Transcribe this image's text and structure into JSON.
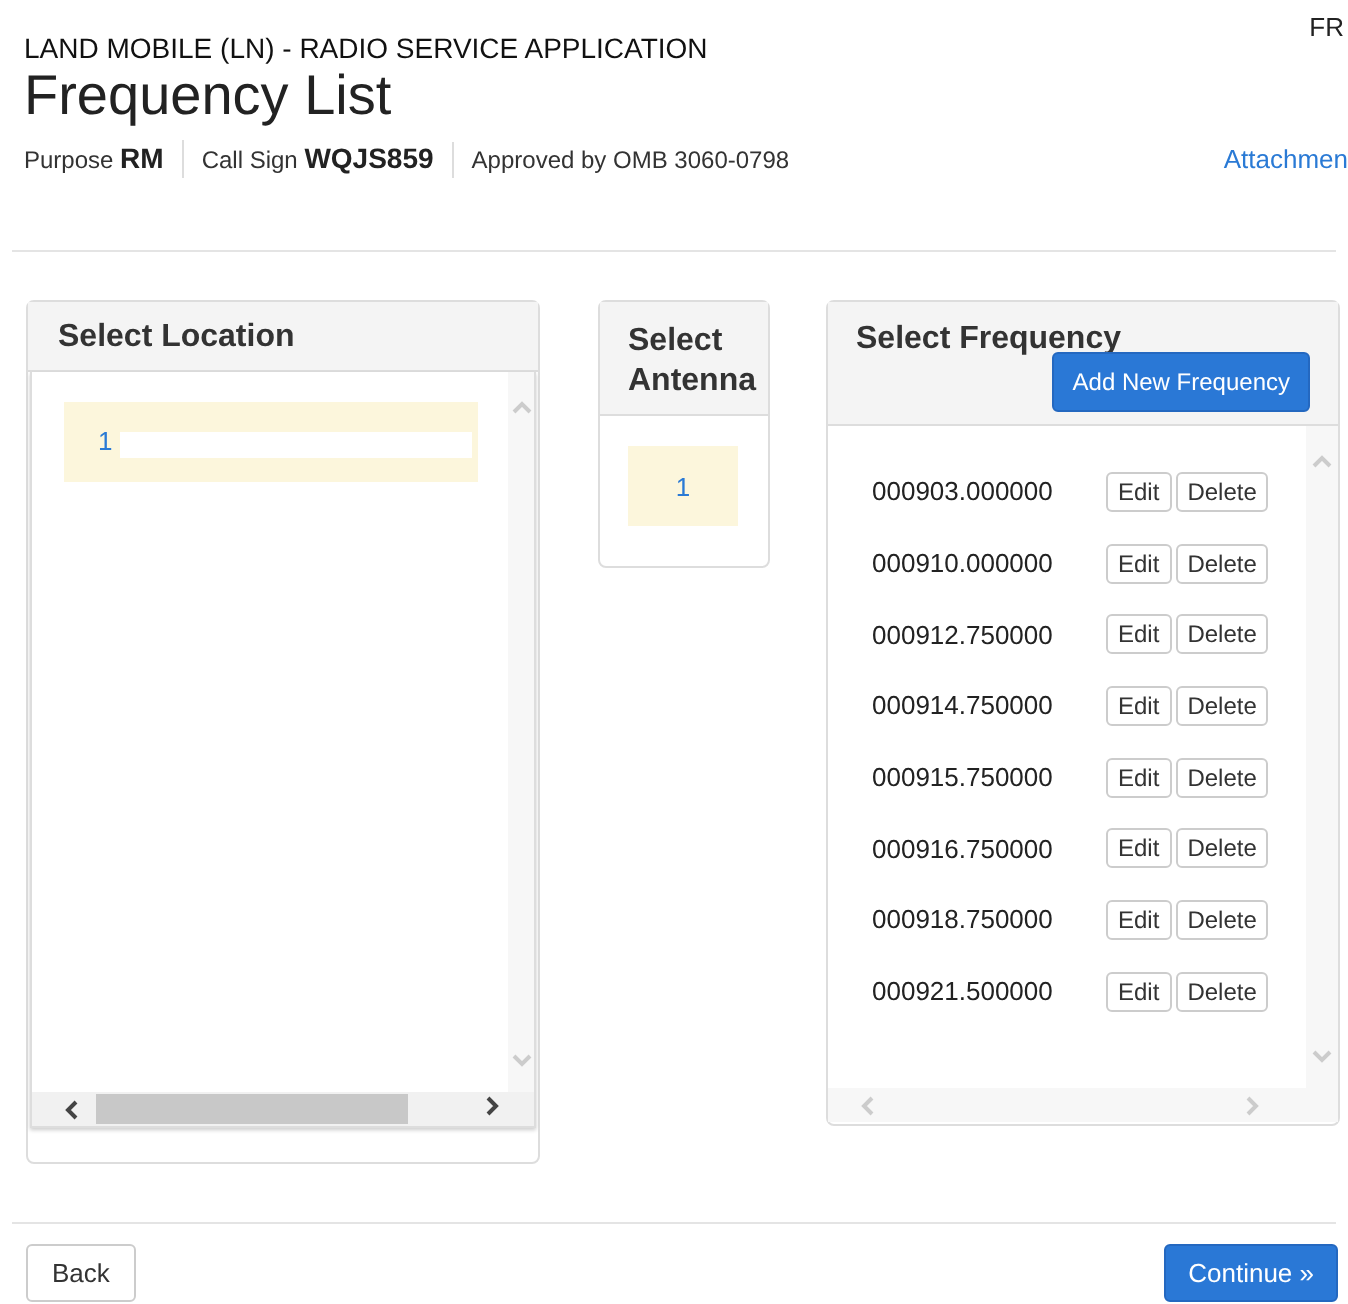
{
  "header": {
    "corner_text": "FR",
    "subtitle": "LAND MOBILE (LN) - RADIO SERVICE APPLICATION",
    "title": "Frequency List",
    "meta": [
      {
        "label": "Purpose",
        "value": "RM"
      },
      {
        "label": "Call Sign",
        "value": "WQJS859"
      },
      {
        "label": "Approved by OMB 3060-0798"
      }
    ],
    "link": "Attachmen"
  },
  "location_panel": {
    "title": "Select Location",
    "items": [
      {
        "label": "1",
        "selected": true
      }
    ]
  },
  "antenna_panel": {
    "title": "Select Antenna",
    "items": [
      {
        "label": "1",
        "selected": true
      }
    ]
  },
  "frequency_panel": {
    "title": "Select Frequency",
    "add_button": "Add New Frequency",
    "rows": [
      {
        "frequency": "000903.000000",
        "edit": "Edit",
        "delete": "Delete"
      },
      {
        "frequency": "000910.000000",
        "edit": "Edit",
        "delete": "Delete"
      },
      {
        "frequency": "000912.750000",
        "edit": "Edit",
        "delete": "Delete"
      },
      {
        "frequency": "000914.750000",
        "edit": "Edit",
        "delete": "Delete"
      },
      {
        "frequency": "000915.750000",
        "edit": "Edit",
        "delete": "Delete"
      },
      {
        "frequency": "000916.750000",
        "edit": "Edit",
        "delete": "Delete"
      },
      {
        "frequency": "000918.750000",
        "edit": "Edit",
        "delete": "Delete"
      },
      {
        "frequency": "000921.500000",
        "edit": "Edit",
        "delete": "Delete"
      }
    ]
  },
  "footer": {
    "back": "Back",
    "continue": "Continue »"
  }
}
